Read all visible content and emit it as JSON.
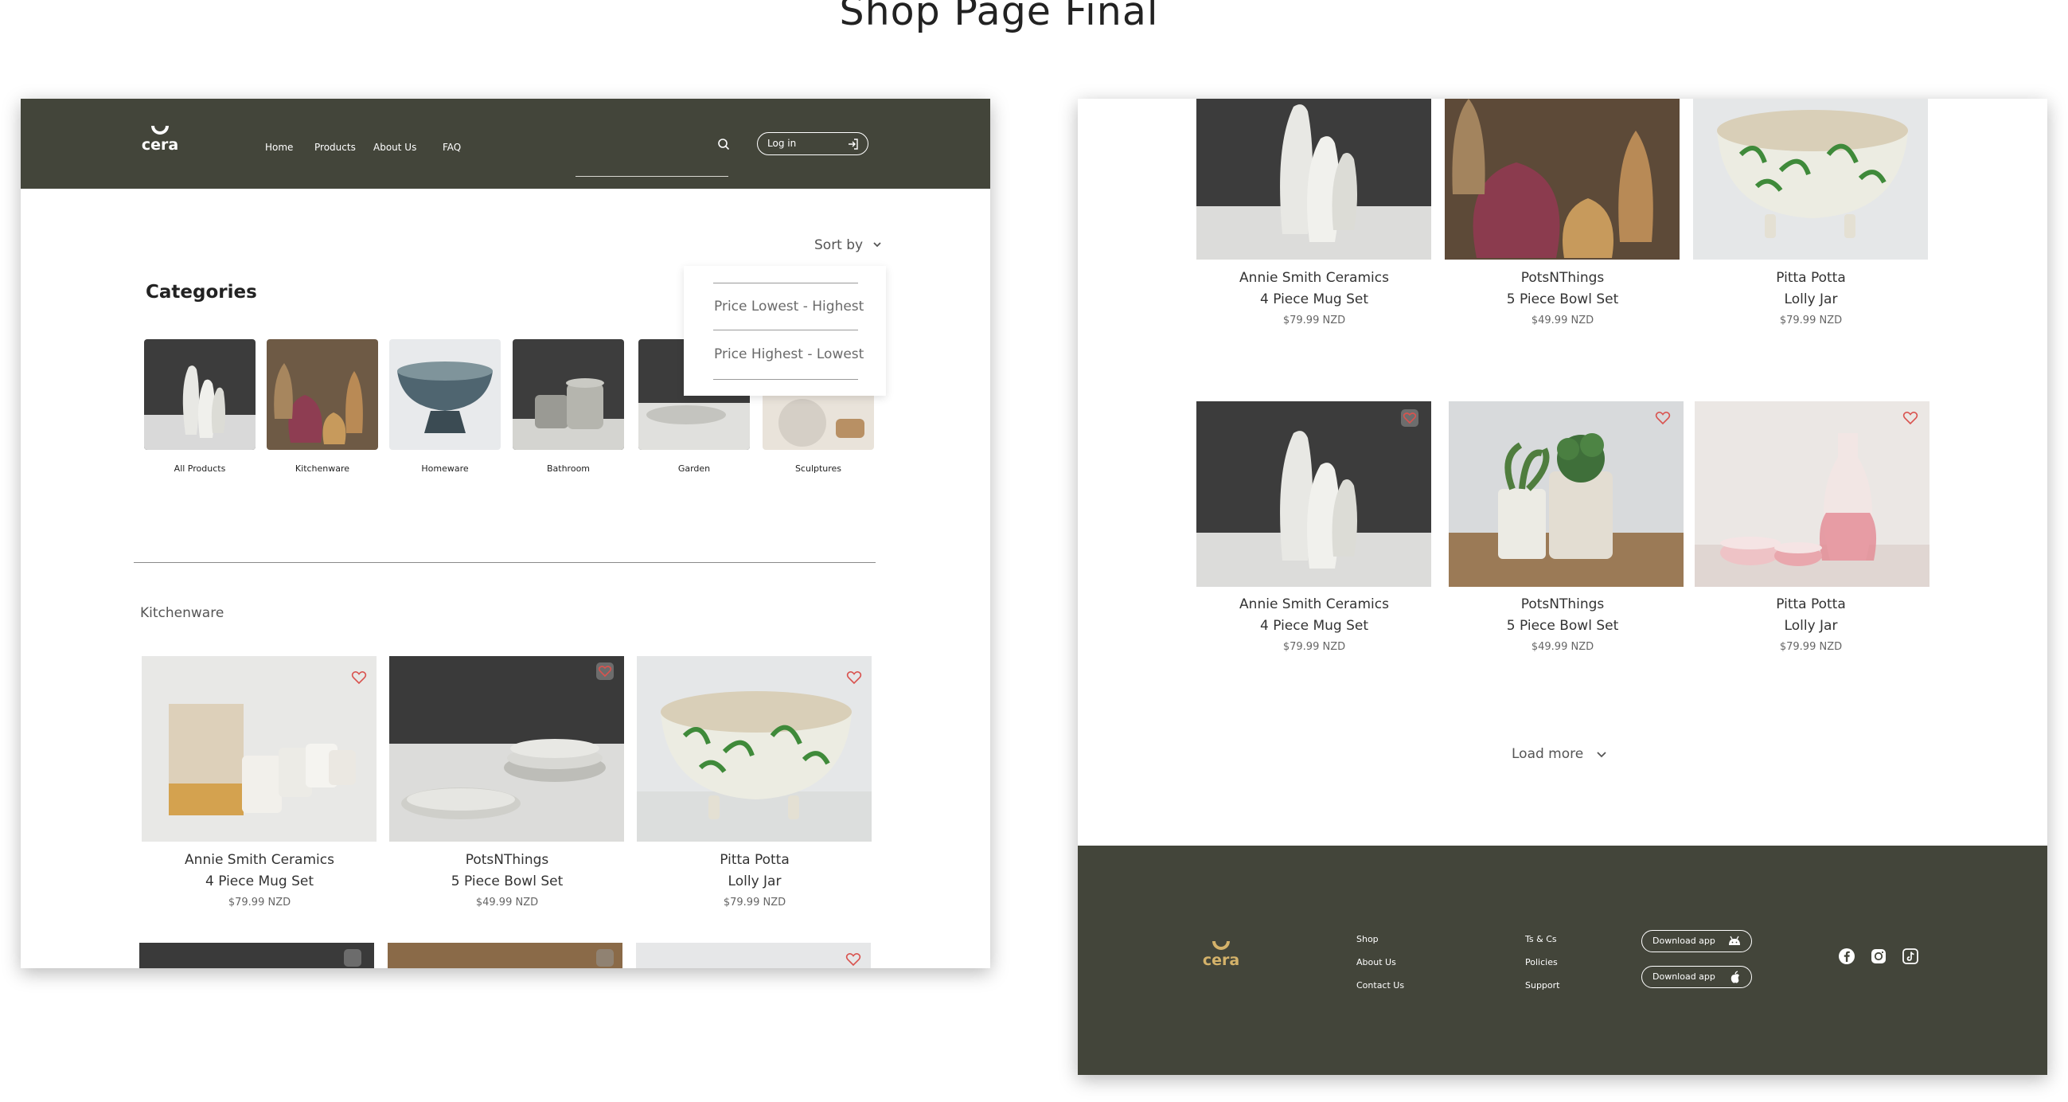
{
  "page": {
    "title": "Shop Page Final"
  },
  "header": {
    "logo": "cera",
    "nav": [
      "Home",
      "Products",
      "About Us",
      "FAQ"
    ],
    "search_placeholder": "",
    "login_label": "Log in"
  },
  "sort": {
    "label": "Sort by",
    "options": [
      "Price Lowest - Highest",
      "Price Highest - Lowest"
    ]
  },
  "categories": {
    "heading": "Categories",
    "items": [
      "All Products",
      "Kitchenware",
      "Homeware",
      "Bathroom",
      "Garden",
      "Sculptures"
    ]
  },
  "section": {
    "heading": "Kitchenware"
  },
  "products": [
    {
      "brand": "Annie Smith Ceramics",
      "name": "4 Piece Mug Set",
      "price": "$79.99 NZD"
    },
    {
      "brand": "PotsNThings",
      "name": "5 Piece Bowl Set",
      "price": "$49.99 NZD"
    },
    {
      "brand": "Pitta Potta",
      "name": "Lolly Jar",
      "price": "$79.99 NZD"
    }
  ],
  "right_products": {
    "row1": [
      {
        "brand": "Annie Smith Ceramics",
        "name": "4 Piece Mug Set",
        "price": "$79.99 NZD"
      },
      {
        "brand": "PotsNThings",
        "name": "5 Piece Bowl Set",
        "price": "$49.99 NZD"
      },
      {
        "brand": "Pitta Potta",
        "name": "Lolly Jar",
        "price": "$79.99 NZD"
      }
    ],
    "row2": [
      {
        "brand": "Annie Smith Ceramics",
        "name": "4 Piece Mug Set",
        "price": "$79.99 NZD"
      },
      {
        "brand": "PotsNThings",
        "name": "5 Piece Bowl Set",
        "price": "$49.99 NZD"
      },
      {
        "brand": "Pitta Potta",
        "name": "Lolly Jar",
        "price": "$79.99 NZD"
      }
    ]
  },
  "load_more": "Load more",
  "footer": {
    "logo": "cera",
    "col1": [
      "Shop",
      "About Us",
      "Contact Us"
    ],
    "col2": [
      "Ts & Cs",
      "Policies",
      "Support"
    ],
    "download_android": "Download app",
    "download_ios": "Download app",
    "social": [
      "facebook-icon",
      "instagram-icon",
      "tiktok-icon"
    ]
  },
  "colors": {
    "header_bg": "#43453a",
    "accent_gold": "#d4b26a",
    "heart_red": "#d9534f"
  }
}
